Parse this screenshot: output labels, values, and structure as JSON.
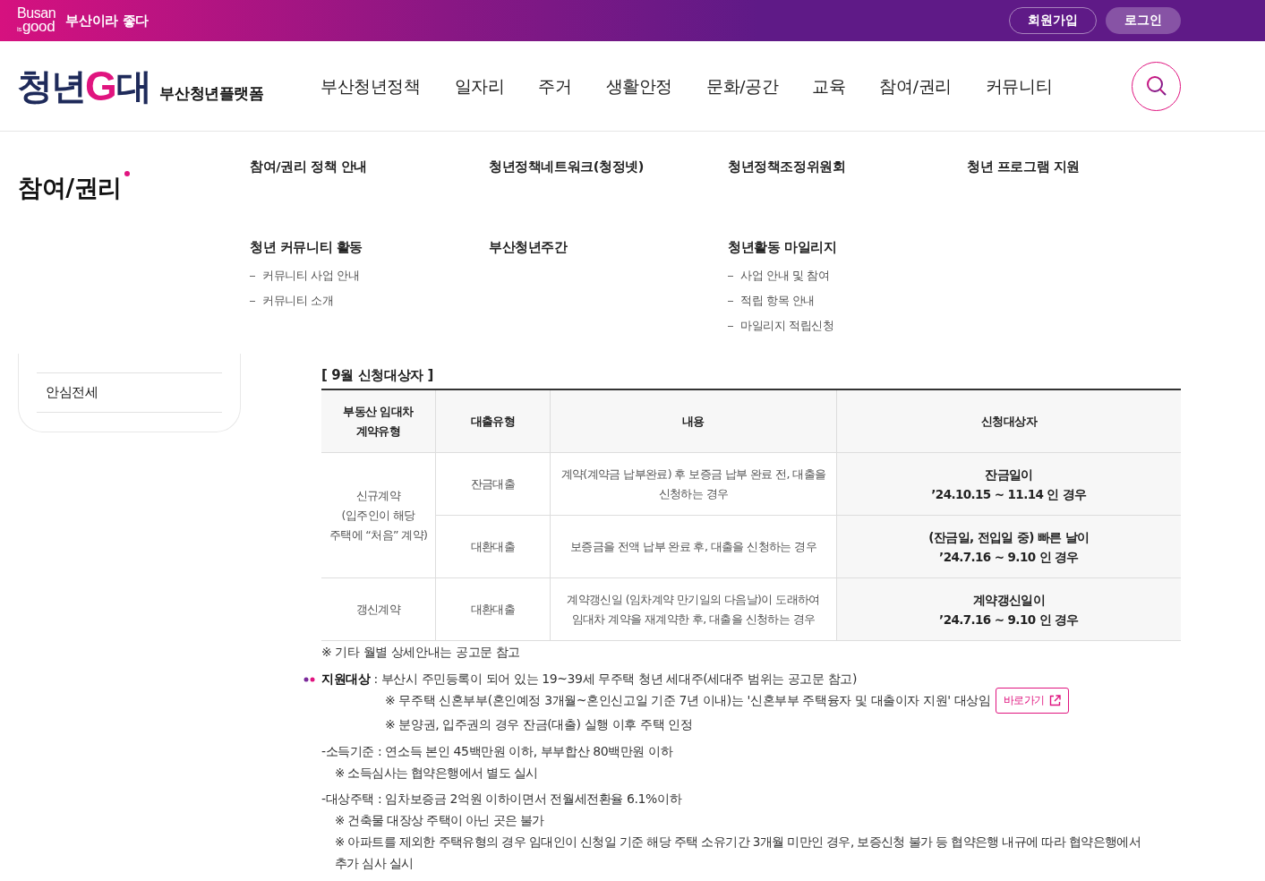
{
  "top_bar": {
    "logo": {
      "line_1": "Busan",
      "small": "is",
      "line_2": "good"
    },
    "slogan": "부산이라 좋다",
    "buttons": [
      {
        "label": "회원가입",
        "kind": "outline"
      },
      {
        "label": "로그인",
        "kind": "filled"
      }
    ]
  },
  "header": {
    "logo": {
      "part_1": "청년",
      "letter": "G",
      "part_2": "대",
      "subtitle": "부산청년플랫폼"
    },
    "nav": [
      "부산청년정책",
      "일자리",
      "주거",
      "생활안정",
      "문화/공간",
      "교육",
      "참여/권리",
      "커뮤니티"
    ]
  },
  "mega_menu": {
    "title": "참여/권리",
    "groups": [
      {
        "label": "참여/권리 정책 안내"
      },
      {
        "label": "청년정책네트워크(청정넷)"
      },
      {
        "label": "청년정책조정위원회"
      },
      {
        "label": "청년 프로그램 지원"
      },
      {
        "label": "청년 커뮤니티 활동",
        "children": [
          "커뮤니티 사업 안내",
          "커뮤니티 소개"
        ]
      },
      {
        "label": "부산청년주간"
      },
      {
        "label": "청년활동 마일리지",
        "children": [
          "사업 안내 및 참여",
          "적립 항목 안내",
          "마일리지 적립신청"
        ]
      }
    ]
  },
  "sidebar": {
    "items": [
      "안심전세"
    ]
  },
  "content": {
    "caption": "[ 9월 신청대상자 ]",
    "table": {
      "columns": [
        "부동산 임대차\n계약유형",
        "대출유형",
        "내용",
        "신청대상자"
      ],
      "groups": [
        {
          "contract_type": "신규계약\n(입주인이 해당\n주택에 “처음” 계약)",
          "rows": [
            {
              "loan_type": "잔금대출",
              "description": "계약(계약금 납부완료) 후 보증금 납부 완료 전, 대출을\n신청하는 경우",
              "target": "잔금일이",
              "period": "’24.10.15 ~ 11.14 인 경우"
            },
            {
              "loan_type": "대환대출",
              "description": "보증금을 전액 납부 완료 후, 대출을 신청하는 경우",
              "target": "(잔금일, 전입일 중) 빠른 날이",
              "period": "’24.7.16 ~ 9.10 인 경우"
            }
          ]
        },
        {
          "contract_type": "갱신계약",
          "rows": [
            {
              "loan_type": "대환대출",
              "description": "계약갱신일 (임차계약 만기일의 다음날)이 도래하여\n임대차 계약을 재계약한 후, 대출을 신청하는 경우",
              "target": "계약갱신일이",
              "period": "’24.7.16 ~ 9.10 인 경우"
            }
          ]
        }
      ]
    },
    "table_note": "※ 기타 월별 상세안내는 공고문 참고",
    "support": {
      "label": "지원대상",
      "text": " : 부산시 주민등록이 되어 있는 19~39세 무주택 청년 세대주(세대주 범위는 공고문 참고)",
      "notes": [
        {
          "text": "※ 무주택 신혼부부(혼인예정 3개월~혼인신고일 기준 7년 이내)는 '신혼부부 주택융자 및 대출이자 지원' 대상임",
          "link": "바로가기"
        },
        {
          "text": "※ 분양권, 입주권의 경우 잔금(대출) 실행 이후 주택 인정"
        }
      ]
    },
    "criteria": [
      {
        "text": "-소득기준 : 연소득 본인 45백만원 이하, 부부합산 80백만원 이하",
        "notes": [
          "※ 소득심사는 협약은행에서 별도 실시"
        ]
      },
      {
        "text": "-대상주택 : 임차보증금 2억원 이하이면서 전월세전환율 6.1%이하",
        "notes": [
          "※ 건축물 대장상 주택이 아닌 곳은 불가",
          "※ 아파트를 제외한 주택유형의 경우 임대인이 신청일 기준 해당 주택 소유기간 3개월 미만인 경우, 보증신청 불가 등 협약은행 내규에 따라 협약은행에서\n추가 심사 실시"
        ]
      }
    ]
  }
}
